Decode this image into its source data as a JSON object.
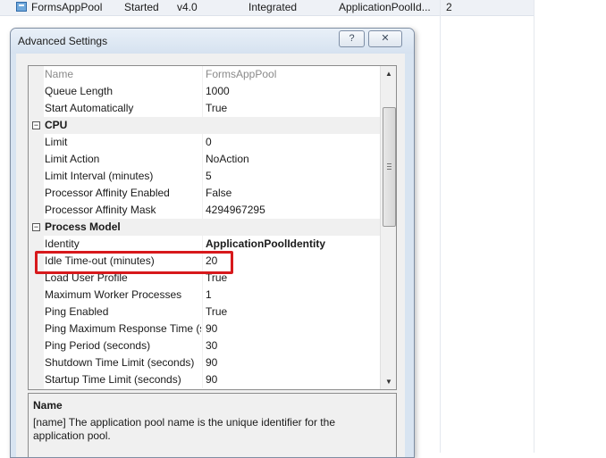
{
  "background_row": {
    "name": "FormsAppPool",
    "status": "Started",
    "clr_version": "v4.0",
    "pipeline_mode": "Integrated",
    "identity": "ApplicationPoolId...",
    "applications": "2"
  },
  "dialog": {
    "title": "Advanced Settings",
    "help_label": "?",
    "close_label": "✕"
  },
  "grid": {
    "rows": [
      {
        "name": "Name",
        "value": "FormsAppPool"
      },
      {
        "name": "Queue Length",
        "value": "1000"
      },
      {
        "name": "Start Automatically",
        "value": "True"
      },
      {
        "category": "CPU",
        "expander": "−"
      },
      {
        "name": "Limit",
        "value": "0"
      },
      {
        "name": "Limit Action",
        "value": "NoAction"
      },
      {
        "name": "Limit Interval (minutes)",
        "value": "5"
      },
      {
        "name": "Processor Affinity Enabled",
        "value": "False"
      },
      {
        "name": "Processor Affinity Mask",
        "value": "4294967295"
      },
      {
        "category": "Process Model",
        "expander": "−"
      },
      {
        "name": "Identity",
        "value": "ApplicationPoolIdentity"
      },
      {
        "name": "Idle Time-out (minutes)",
        "value": "20"
      },
      {
        "name": "Load User Profile",
        "value": "True"
      },
      {
        "name": "Maximum Worker Processes",
        "value": "1"
      },
      {
        "name": "Ping Enabled",
        "value": "True"
      },
      {
        "name": "Ping Maximum Response Time (s",
        "value": "90"
      },
      {
        "name": "Ping Period (seconds)",
        "value": "30"
      },
      {
        "name": "Shutdown Time Limit (seconds)",
        "value": "90"
      },
      {
        "name": "Startup Time Limit (seconds)",
        "value": "90"
      }
    ]
  },
  "scrollbar": {
    "up": "▲",
    "down": "▼"
  },
  "description": {
    "title": "Name",
    "text": "[name] The application pool name is the unique identifier for the application pool."
  }
}
